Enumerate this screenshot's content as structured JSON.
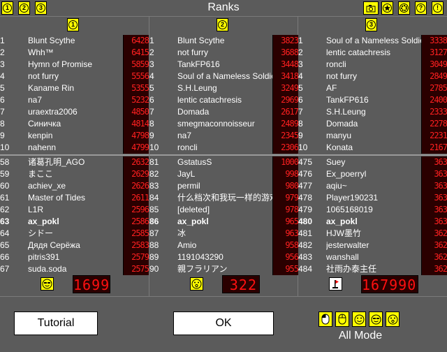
{
  "window": {
    "title": "Ranks"
  },
  "top_left_tabs": [
    "1",
    "2",
    "3"
  ],
  "top_right_icons": [
    "camera-icon",
    "star-icon",
    "gear-icon",
    "help-icon",
    "alert-icon"
  ],
  "columns": [
    {
      "tab_label": "1",
      "top": [
        {
          "rank": "1",
          "name": "Blunt Scythe",
          "score": "6428"
        },
        {
          "rank": "2",
          "name": "Whh™",
          "score": "6415"
        },
        {
          "rank": "3",
          "name": "Hymn of Promise",
          "score": "5859"
        },
        {
          "rank": "4",
          "name": "not furry",
          "score": "5556"
        },
        {
          "rank": "5",
          "name": "Kaname Rin",
          "score": "5355"
        },
        {
          "rank": "6",
          "name": "na7",
          "score": "5232"
        },
        {
          "rank": "7",
          "name": "uraextra2006",
          "score": "4850"
        },
        {
          "rank": "8",
          "name": "Синичка",
          "score": "4814"
        },
        {
          "rank": "9",
          "name": "kenpin",
          "score": "4798"
        },
        {
          "rank": "10",
          "name": "nahenn",
          "score": "4799"
        }
      ],
      "near": [
        {
          "rank": "58",
          "name": "诸葛孔明_AGO",
          "score": "2632"
        },
        {
          "rank": "59",
          "name": "まここ",
          "score": "2629"
        },
        {
          "rank": "60",
          "name": "achiev_xe",
          "score": "2626"
        },
        {
          "rank": "61",
          "name": "Master of Tides",
          "score": "2611"
        },
        {
          "rank": "62",
          "name": "L1R",
          "score": "2596"
        },
        {
          "rank": "63",
          "name": "ax_pokl",
          "score": "2586",
          "me": true
        },
        {
          "rank": "64",
          "name": "シドー",
          "score": "2585"
        },
        {
          "rank": "65",
          "name": "Дядя Серёжа",
          "score": "2583"
        },
        {
          "rank": "66",
          "name": "pitris391",
          "score": "2579"
        },
        {
          "rank": "67",
          "name": "suda.soda",
          "score": "2575"
        }
      ],
      "foot_icon": "smiley-sunglasses-icon",
      "foot_score": "1699"
    },
    {
      "tab_label": "2",
      "top": [
        {
          "rank": "1",
          "name": "Blunt Scythe",
          "score": "3823"
        },
        {
          "rank": "2",
          "name": "not furry",
          "score": "3688"
        },
        {
          "rank": "3",
          "name": "TankFP616",
          "score": "3448"
        },
        {
          "rank": "4",
          "name": "Soul of a Nameless Soldier",
          "score": "3418"
        },
        {
          "rank": "5",
          "name": "S.H.Leung",
          "score": "3249"
        },
        {
          "rank": "6",
          "name": "lentic catachresis",
          "score": "2969"
        },
        {
          "rank": "7",
          "name": "Domada",
          "score": "2617"
        },
        {
          "rank": "8",
          "name": "smegmaconnoisseur",
          "score": "2489"
        },
        {
          "rank": "9",
          "name": "na7",
          "score": "2345"
        },
        {
          "rank": "10",
          "name": "roncli",
          "score": "2306"
        }
      ],
      "near": [
        {
          "rank": "81",
          "name": "GstatusS",
          "score": "1000"
        },
        {
          "rank": "82",
          "name": "JayL",
          "score": "998"
        },
        {
          "rank": "83",
          "name": "permil",
          "score": "980"
        },
        {
          "rank": "84",
          "name": "什么档次和我玩一样的游戏",
          "score": "979"
        },
        {
          "rank": "85",
          "name": "[deleted]",
          "score": "978"
        },
        {
          "rank": "86",
          "name": "ax_pokl",
          "score": "965",
          "me": true
        },
        {
          "rank": "87",
          "name": "冰",
          "score": "963"
        },
        {
          "rank": "88",
          "name": "Amio",
          "score": "958"
        },
        {
          "rank": "89",
          "name": "1191043290",
          "score": "956"
        },
        {
          "rank": "90",
          "name": "親フラリアン",
          "score": "955"
        }
      ],
      "foot_icon": "smiley-surprised-icon",
      "foot_score": "322"
    },
    {
      "tab_label": "3",
      "top": [
        {
          "rank": "1",
          "name": "Soul of a Nameless Soldier",
          "score": "3338"
        },
        {
          "rank": "2",
          "name": "lentic catachresis",
          "score": "3127"
        },
        {
          "rank": "3",
          "name": "roncli",
          "score": "3049"
        },
        {
          "rank": "4",
          "name": "not furry",
          "score": "2849"
        },
        {
          "rank": "5",
          "name": "AF",
          "score": "2785"
        },
        {
          "rank": "6",
          "name": "TankFP616",
          "score": "2400"
        },
        {
          "rank": "7",
          "name": "S.H.Leung",
          "score": "2333"
        },
        {
          "rank": "8",
          "name": "Domada",
          "score": "2278"
        },
        {
          "rank": "9",
          "name": "manyu",
          "score": "2231"
        },
        {
          "rank": "10",
          "name": "Konata",
          "score": "2167"
        }
      ],
      "near": [
        {
          "rank": "475",
          "name": "Suey",
          "score": "363"
        },
        {
          "rank": "476",
          "name": "Ex_poerryl",
          "score": "363"
        },
        {
          "rank": "477",
          "name": "aqiu~",
          "score": "363"
        },
        {
          "rank": "478",
          "name": "Player190231",
          "score": "363"
        },
        {
          "rank": "479",
          "name": "1065168019",
          "score": "363"
        },
        {
          "rank": "480",
          "name": "ax_pokl",
          "score": "363",
          "me": true
        },
        {
          "rank": "481",
          "name": "HJW墨竹",
          "score": "362"
        },
        {
          "rank": "482",
          "name": "jesterwalter",
          "score": "362"
        },
        {
          "rank": "483",
          "name": "wanshall",
          "score": "362"
        },
        {
          "rank": "484",
          "name": "社雨办泰主任",
          "score": "362"
        }
      ],
      "foot_icon": "flag-icon",
      "foot_score": "167990"
    }
  ],
  "buttons": {
    "tutorial": "Tutorial",
    "ok": "OK"
  },
  "mode_icons": [
    "mouse-left-icon",
    "mouse-icon",
    "smiley-icon",
    "smiley-sunglasses-icon",
    "smiley-surprised-icon"
  ],
  "mode_label": "All Mode",
  "colors": {
    "background": "#5b5b5b",
    "button_yellow": "#ffff00",
    "score_red": "#ff2020",
    "score_bg": "#2a0000"
  }
}
